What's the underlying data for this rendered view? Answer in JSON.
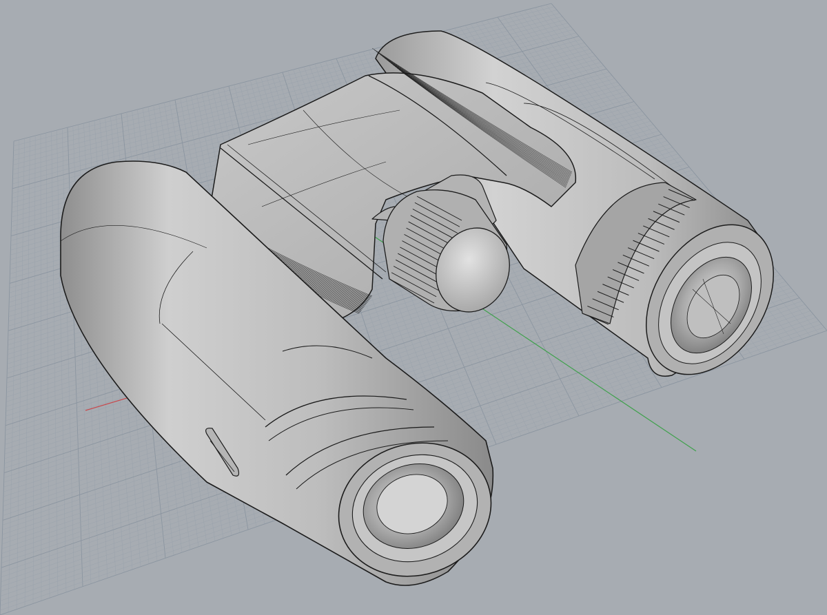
{
  "viewport": {
    "projection": "perspective",
    "display_mode": "shaded",
    "background_color": "#a7acb2",
    "grid": {
      "visible": true,
      "line_color": "#98a1ab",
      "major_line_color": "#8b95a0",
      "x_axis_color": "#c8464a",
      "y_axis_color": "#3fa14c"
    }
  },
  "model": {
    "object": "binoculars",
    "surface_color": "#b9b9b9",
    "edge_color": "#1b1b1b",
    "parts": [
      "left-barrel",
      "right-barrel",
      "center-bridge",
      "focus-knob",
      "diopter-ring",
      "strap-lug",
      "left-lens",
      "right-lens"
    ]
  }
}
